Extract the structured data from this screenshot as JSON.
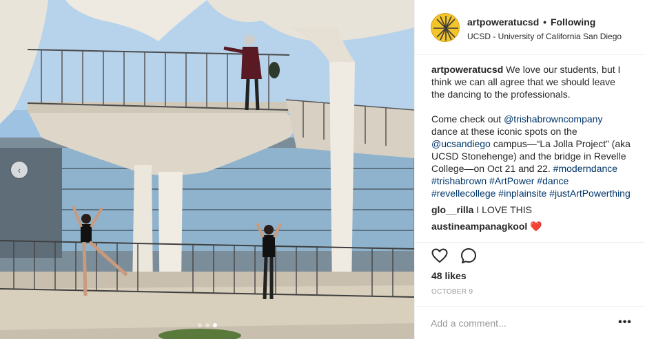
{
  "post": {
    "username": "artpoweratucsd",
    "separator": "•",
    "follow_state": "Following",
    "location": "UCSD - University of California San Diego"
  },
  "caption": {
    "username": "artpoweratucsd",
    "text1": " We love our students, but I think we can all agree that we should leave the dancing to the professionals.",
    "text2a": "Come check out ",
    "mention1": "@trishabrowncompany",
    "text2b": " dance at these iconic spots on the ",
    "mention2": "@ucsandiego",
    "text2c": " campus—“La Jolla Project” (aka UCSD Stonehenge) and the bridge in Revelle College—on Oct 21 and 22. ",
    "hashtags": [
      "#moderndance",
      "#trishabrown",
      "#ArtPower",
      "#dance",
      "#revellecollege",
      "#inplainsite",
      "#justArtPowerthing"
    ]
  },
  "comments": [
    {
      "user": "glo__rilla",
      "text": "I LOVE THIS"
    },
    {
      "user": "austineampanagkool",
      "text": "❤️"
    }
  ],
  "engagement": {
    "likes": "48 likes",
    "date": "OCTOBER 9"
  },
  "compose": {
    "placeholder": "Add a comment...",
    "more_label": "•••"
  },
  "carousel": {
    "prev_label": "‹",
    "active_index": 2,
    "count": 3
  },
  "icons": {
    "like": "heart-icon",
    "comment": "comment-bubble-icon",
    "options": "more-options-icon"
  },
  "colors": {
    "link": "#003569",
    "avatar": "#f3c52a",
    "muted": "#999999"
  }
}
